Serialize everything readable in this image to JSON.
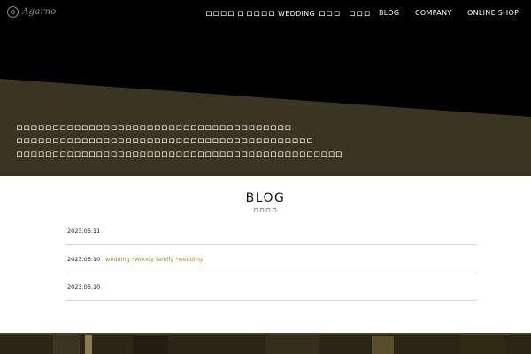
{
  "logo": {
    "text": "Agarno",
    "icon": "agarno-logo-mark"
  },
  "nav": {
    "items": [
      {
        "label": "ロロロロ ロ"
      },
      {
        "label": "ロロロロ WEDDING"
      },
      {
        "label": "ロロロ"
      },
      {
        "label": "ロロロ"
      },
      {
        "label": "BLOG"
      },
      {
        "label": "COMPANY"
      },
      {
        "label": "ONLINE SHOP"
      }
    ]
  },
  "hero": {
    "lines": [
      "ロロロロロロロロロロロロロロロロロロロロロロロロロロロロロロロロロロロロロロ",
      "ロロロロロロロロロロロロロロロロロロロロロロロロロロロロロロロロロロロロロロロロロ",
      "ロロロロロロロロロロロロロロロロロロロロロロロロロロロロロロロロロロロロロロロロロロロロロ"
    ]
  },
  "blog": {
    "title": "BLOG",
    "subtitle": "ロロロロ",
    "posts": [
      {
        "date": "2023.06.11",
        "title": ""
      },
      {
        "date": "2023.06.10",
        "title": "wedding *Woody family *wedding"
      },
      {
        "date": "2023.06.10",
        "title": ""
      }
    ]
  },
  "colors": {
    "accent": "#b8902e",
    "hero_band": "#3a3520",
    "divider": "#d8d4c8"
  }
}
